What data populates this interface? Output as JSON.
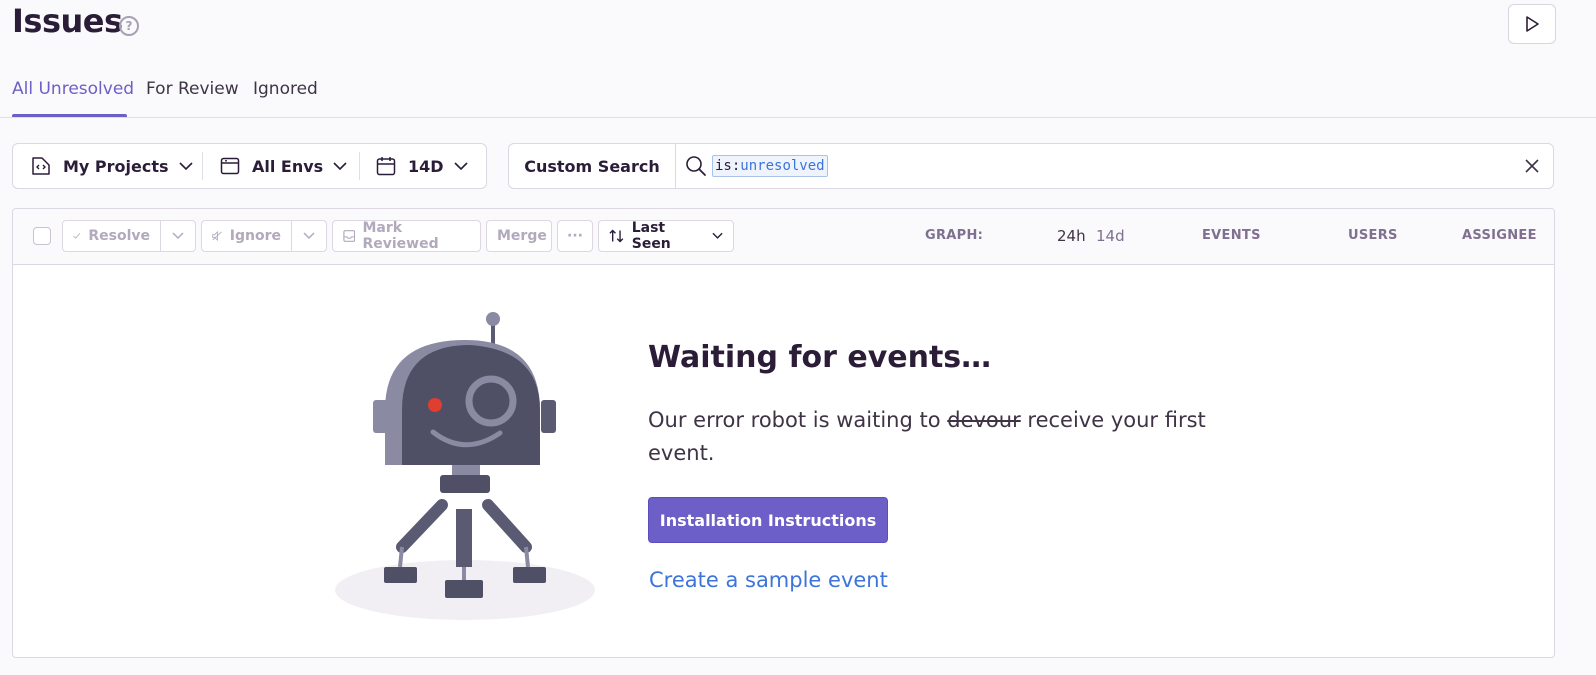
{
  "header": {
    "title": "Issues",
    "help_icon": "question-circle-icon",
    "play_icon": "play-icon"
  },
  "tabs": [
    {
      "label": "All Unresolved",
      "active": true
    },
    {
      "label": "For Review",
      "active": false
    },
    {
      "label": "Ignored",
      "active": false
    }
  ],
  "filters": {
    "project": {
      "label": "My Projects",
      "icon": "project-icon"
    },
    "environment": {
      "label": "All Envs",
      "icon": "window-icon"
    },
    "date": {
      "label": "14D",
      "icon": "calendar-icon"
    }
  },
  "search": {
    "custom_label": "Custom Search",
    "query_key": "is:",
    "query_value": "unresolved"
  },
  "toolbar": {
    "resolve": "Resolve",
    "ignore": "Ignore",
    "mark_reviewed": "Mark Reviewed",
    "merge": "Merge",
    "more": "···",
    "sort": "Last Seen"
  },
  "columns": {
    "graph": "GRAPH:",
    "graph_24h": "24h",
    "graph_14d": "14d",
    "events": "EVENTS",
    "users": "USERS",
    "assignee": "ASSIGNEE"
  },
  "empty_state": {
    "title": "Waiting for events…",
    "desc_before": "Our error robot is waiting to ",
    "desc_struck": "devour",
    "desc_after": " receive your first event.",
    "install_button": "Installation Instructions",
    "sample_link": "Create a sample event"
  },
  "colors": {
    "accent": "#6c5fc7",
    "link": "#3d74db",
    "text": "#2b1d38"
  }
}
